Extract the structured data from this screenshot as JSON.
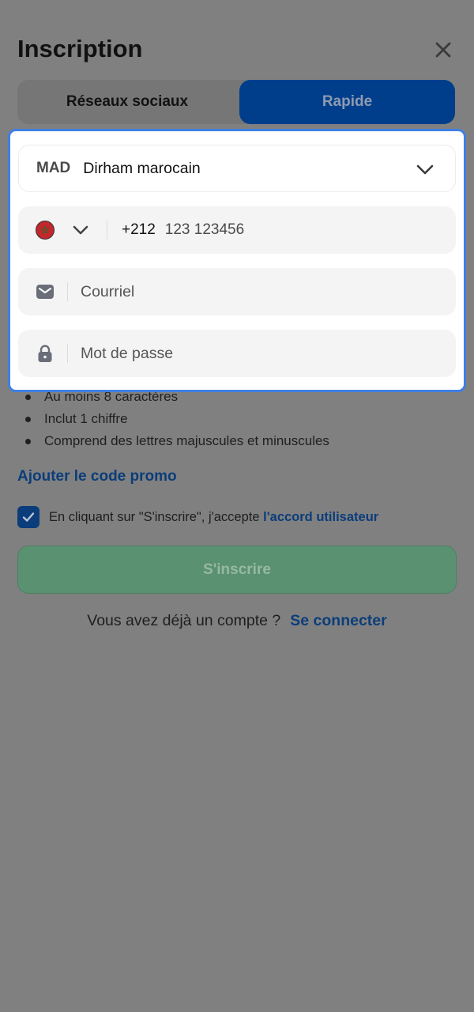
{
  "header": {
    "title": "Inscription"
  },
  "tabs": [
    {
      "label": "Réseaux sociaux",
      "active": false
    },
    {
      "label": "Rapide",
      "active": true
    }
  ],
  "form": {
    "currency": {
      "code": "MAD",
      "name": "Dirham marocain"
    },
    "phone": {
      "country_code": "+212",
      "placeholder": "123 123456"
    },
    "email": {
      "placeholder": "Courriel"
    },
    "password": {
      "placeholder": "Mot de passe"
    }
  },
  "password_rules": [
    "Au moins 8 caractères",
    "Inclut 1 chiffre",
    "Comprend des lettres majuscules et minuscules"
  ],
  "promo": {
    "label": "Ajouter le code promo"
  },
  "terms": {
    "text": "En cliquant sur \"S'inscrire\", j'accepte ",
    "link": "l'accord utilisateur",
    "checked": true
  },
  "submit": {
    "label": "S'inscrire"
  },
  "login": {
    "text": "Vous avez déjà un compte ?",
    "link": "Se connecter"
  },
  "colors": {
    "overlay": "#808080",
    "highlight_border": "#3f7fe3",
    "primary": "#0b3d7a",
    "submit": "#5a9170",
    "flag_red": "#c1272d"
  },
  "icons": {
    "close": "close-icon",
    "chevron": "chevron-down-icon",
    "flag": "morocco-flag-icon",
    "mail": "mail-icon",
    "lock": "lock-icon",
    "check": "check-icon"
  }
}
